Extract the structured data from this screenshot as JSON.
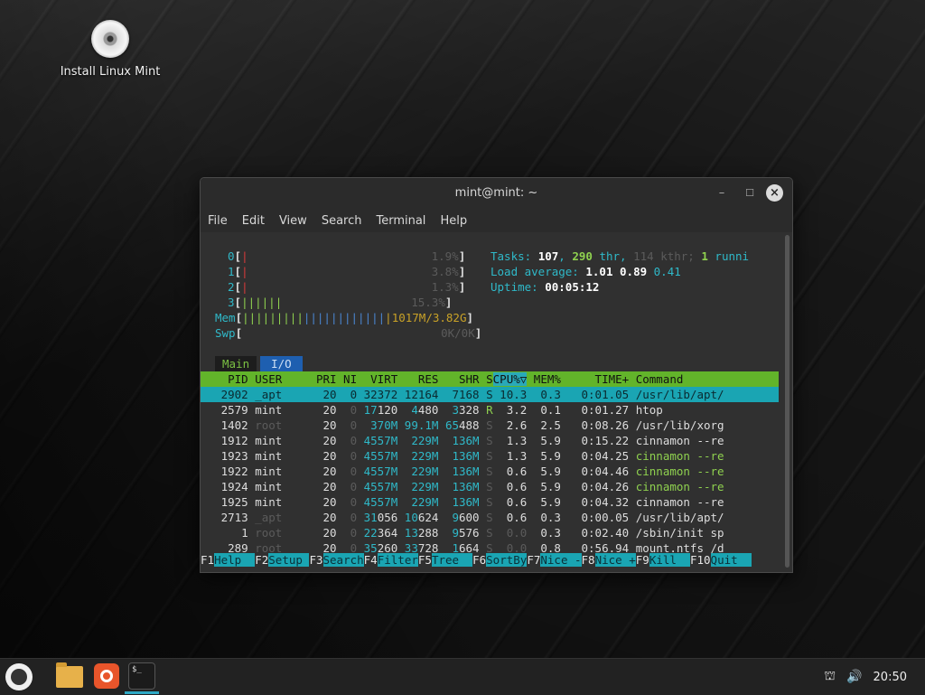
{
  "desktop": {
    "install_label": "Install Linux Mint"
  },
  "window": {
    "title": "mint@mint: ~",
    "menu": [
      "File",
      "Edit",
      "View",
      "Search",
      "Terminal",
      "Help"
    ]
  },
  "htop": {
    "cpu_rows": [
      {
        "label": "0",
        "bars": "|",
        "value": "1.9%"
      },
      {
        "label": "1",
        "bars": "|",
        "value": "3.8%"
      },
      {
        "label": "2",
        "bars": "|",
        "value": "1.3%"
      },
      {
        "label": "3",
        "bars": "||||||",
        "value": "15.3%"
      }
    ],
    "mem": {
      "label": "Mem",
      "bars": "||||||||||||||||||||||",
      "value": "1017M/3.82G"
    },
    "swp": {
      "label": "Swp",
      "value": "0K/0K"
    },
    "tasks": {
      "label": "Tasks:",
      "tasks": "107",
      "thr_count": "290",
      "thr_label": "thr,",
      "kthr_count": "114",
      "kthr_label": "kthr;",
      "running": "1",
      "running_label": "runni"
    },
    "load": {
      "label": "Load average:",
      "v1": "1.01",
      "v2": "0.89",
      "v3": "0.41"
    },
    "uptime": {
      "label": "Uptime:",
      "value": "00:05:12"
    },
    "tabs": [
      "Main",
      "I/O"
    ],
    "columns": [
      "PID",
      "USER",
      "PRI",
      "NI",
      "VIRT",
      "RES",
      "SHR",
      "S",
      "CPU%",
      "MEM%",
      "TIME+",
      "Command"
    ],
    "sort_marker": "▽",
    "processes": [
      {
        "pid": "2902",
        "user": "_apt",
        "pri": "20",
        "ni": "0",
        "virt": "32372",
        "res": "12164",
        "shr": "7168",
        "s": "S",
        "cpu": "10.3",
        "mem": "0.3",
        "time": "0:01.05",
        "cmd": "/usr/lib/apt/",
        "selected": true
      },
      {
        "pid": "2579",
        "user": "mint",
        "pri": "20",
        "ni": "0",
        "virt": "17120",
        "res": "4480",
        "shr": "3328",
        "s": "R",
        "cpu": "3.2",
        "mem": "0.1",
        "time": "0:01.27",
        "cmd": "htop"
      },
      {
        "pid": "1402",
        "user": "root",
        "pri": "20",
        "ni": "0",
        "virt": "370M",
        "res": "99.1M",
        "shr": "65488",
        "s": "S",
        "cpu": "2.6",
        "mem": "2.5",
        "time": "0:08.26",
        "cmd": "/usr/lib/xorg"
      },
      {
        "pid": "1912",
        "user": "mint",
        "pri": "20",
        "ni": "0",
        "virt": "4557M",
        "res": "229M",
        "shr": "136M",
        "s": "S",
        "cpu": "1.3",
        "mem": "5.9",
        "time": "0:15.22",
        "cmd": "cinnamon --re"
      },
      {
        "pid": "1923",
        "user": "mint",
        "pri": "20",
        "ni": "0",
        "virt": "4557M",
        "res": "229M",
        "shr": "136M",
        "s": "S",
        "cpu": "1.3",
        "mem": "5.9",
        "time": "0:04.25",
        "cmd": "cinnamon --re"
      },
      {
        "pid": "1922",
        "user": "mint",
        "pri": "20",
        "ni": "0",
        "virt": "4557M",
        "res": "229M",
        "shr": "136M",
        "s": "S",
        "cpu": "0.6",
        "mem": "5.9",
        "time": "0:04.46",
        "cmd": "cinnamon --re"
      },
      {
        "pid": "1924",
        "user": "mint",
        "pri": "20",
        "ni": "0",
        "virt": "4557M",
        "res": "229M",
        "shr": "136M",
        "s": "S",
        "cpu": "0.6",
        "mem": "5.9",
        "time": "0:04.26",
        "cmd": "cinnamon --re"
      },
      {
        "pid": "1925",
        "user": "mint",
        "pri": "20",
        "ni": "0",
        "virt": "4557M",
        "res": "229M",
        "shr": "136M",
        "s": "S",
        "cpu": "0.6",
        "mem": "5.9",
        "time": "0:04.32",
        "cmd": "cinnamon --re"
      },
      {
        "pid": "2713",
        "user": "_apt",
        "pri": "20",
        "ni": "0",
        "virt": "31056",
        "res": "10624",
        "shr": "9600",
        "s": "S",
        "cpu": "0.6",
        "mem": "0.3",
        "time": "0:00.05",
        "cmd": "/usr/lib/apt/"
      },
      {
        "pid": "1",
        "user": "root",
        "pri": "20",
        "ni": "0",
        "virt": "22364",
        "res": "13288",
        "shr": "9576",
        "s": "S",
        "cpu": "0.0",
        "mem": "0.3",
        "time": "0:02.40",
        "cmd": "/sbin/init sp"
      },
      {
        "pid": "289",
        "user": "root",
        "pri": "20",
        "ni": "0",
        "virt": "35260",
        "res": "33728",
        "shr": "1664",
        "s": "S",
        "cpu": "0.0",
        "mem": "0.8",
        "time": "0:56.94",
        "cmd": "mount.ntfs /d"
      }
    ],
    "fkeys": [
      {
        "key": "F1",
        "label": "Help"
      },
      {
        "key": "F2",
        "label": "Setup"
      },
      {
        "key": "F3",
        "label": "Search"
      },
      {
        "key": "F4",
        "label": "Filter"
      },
      {
        "key": "F5",
        "label": "Tree"
      },
      {
        "key": "F6",
        "label": "SortBy"
      },
      {
        "key": "F7",
        "label": "Nice -"
      },
      {
        "key": "F8",
        "label": "Nice +"
      },
      {
        "key": "F9",
        "label": "Kill"
      },
      {
        "key": "F10",
        "label": "Quit"
      }
    ]
  },
  "taskbar": {
    "clock": "20:50",
    "terminal_icon_text": "$_"
  }
}
